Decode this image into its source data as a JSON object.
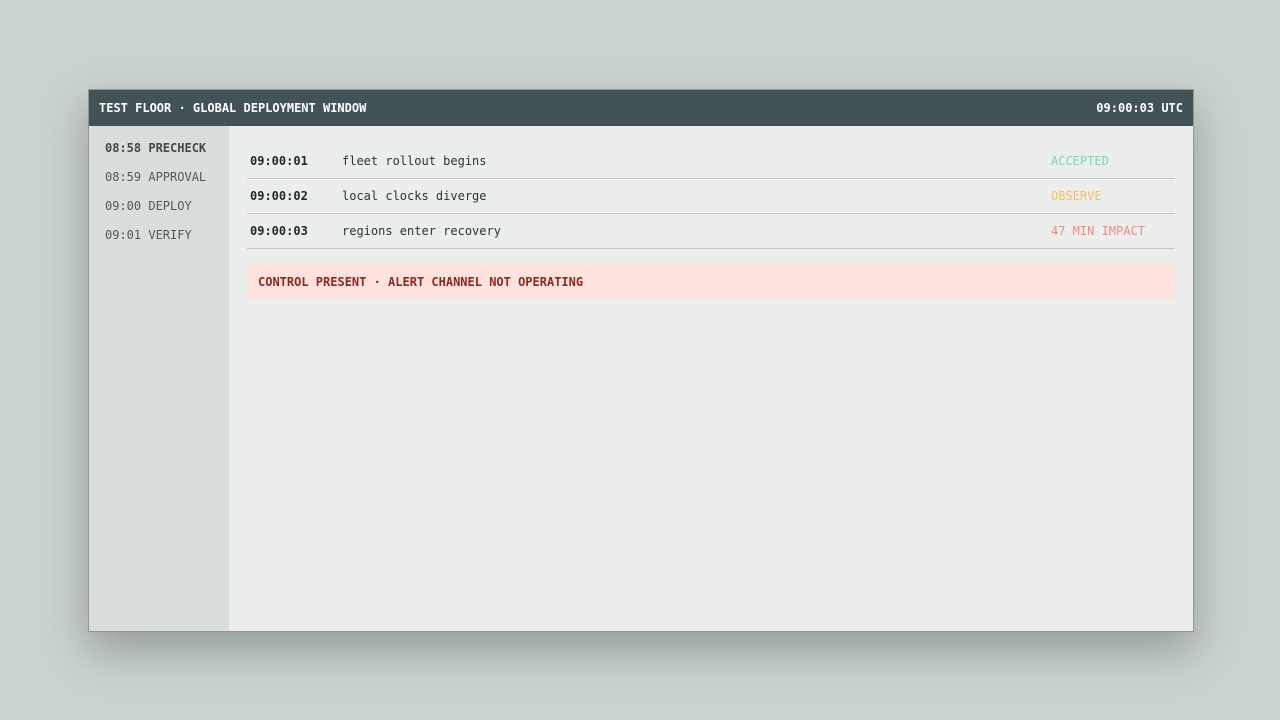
{
  "header": {
    "title": "TEST FLOOR · GLOBAL DEPLOYMENT WINDOW",
    "clock": "09:00:03 UTC"
  },
  "sidebar": {
    "items": [
      {
        "label": "08:58 PRECHECK",
        "active": true
      },
      {
        "label": "08:59 APPROVAL",
        "active": false
      },
      {
        "label": "09:00 DEPLOY",
        "active": false
      },
      {
        "label": "09:01 VERIFY",
        "active": false
      }
    ]
  },
  "events": [
    {
      "time": "09:00:01",
      "description": "fleet rollout begins",
      "status": "ACCEPTED",
      "status_color": "#7fd9a8"
    },
    {
      "time": "09:00:02",
      "description": "local clocks diverge",
      "status": "OBSERVE",
      "status_color": "#f2c26b"
    },
    {
      "time": "09:00:03",
      "description": "regions enter recovery",
      "status": "47 MIN IMPACT",
      "status_color": "#ee8a86"
    }
  ],
  "alert": {
    "text": "CONTROL PRESENT · ALERT CHANNEL NOT OPERATING"
  },
  "colors": {
    "background": "#cbd3d0",
    "titlebar": "#435257",
    "sidebar": "#dadedb",
    "panel": "#eceeed",
    "alert_bg": "#fde2de",
    "alert_text": "#8b2a22"
  }
}
